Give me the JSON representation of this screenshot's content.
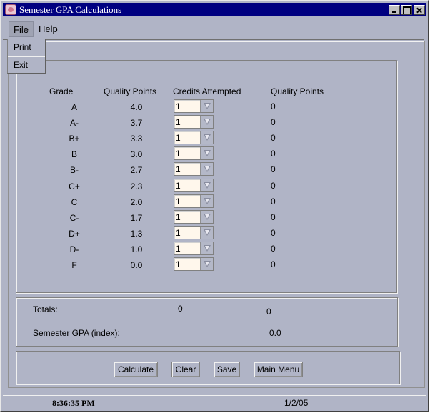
{
  "window": {
    "title": "Semester GPA Calculations",
    "controls": {
      "minimize": "minimize",
      "maximize": "maximize",
      "close": "close"
    }
  },
  "menubar": {
    "items": [
      {
        "label": "File",
        "mnemonic": "F",
        "rest": "ile",
        "open": true
      },
      {
        "label": "Help"
      }
    ],
    "file_menu": [
      {
        "label": "Print",
        "mnemonic": "P",
        "rest": "rint"
      },
      {
        "label": "Exit",
        "pre": "E",
        "mnemonic": "x",
        "rest": "it"
      }
    ]
  },
  "table": {
    "headers": {
      "grade": "Grade",
      "quality_points": "Quality Points",
      "credits": "Credits Attempted",
      "earned_points": "Quality Points"
    },
    "rows": [
      {
        "grade": "A",
        "qp": "4.0",
        "credits": "1",
        "earned": "0"
      },
      {
        "grade": "A-",
        "qp": "3.7",
        "credits": "1",
        "earned": "0"
      },
      {
        "grade": "B+",
        "qp": "3.3",
        "credits": "1",
        "earned": "0"
      },
      {
        "grade": "B",
        "qp": "3.0",
        "credits": "1",
        "earned": "0"
      },
      {
        "grade": "B-",
        "qp": "2.7",
        "credits": "1",
        "earned": "0"
      },
      {
        "grade": "C+",
        "qp": "2.3",
        "credits": "1",
        "earned": "0"
      },
      {
        "grade": "C",
        "qp": "2.0",
        "credits": "1",
        "earned": "0"
      },
      {
        "grade": "C-",
        "qp": "1.7",
        "credits": "1",
        "earned": "0"
      },
      {
        "grade": "D+",
        "qp": "1.3",
        "credits": "1",
        "earned": "0"
      },
      {
        "grade": "D-",
        "qp": "1.0",
        "credits": "1",
        "earned": "0"
      },
      {
        "grade": "F",
        "qp": "0.0",
        "credits": "1",
        "earned": "0"
      }
    ]
  },
  "totals": {
    "label": "Totals:",
    "credits_total": "0",
    "points_total": "0",
    "gpa_label": "Semester GPA (index):",
    "gpa_value": "0.0"
  },
  "buttons": {
    "calculate": "Calculate",
    "clear": "Clear",
    "save": "Save",
    "main_menu": "Main Menu"
  },
  "status": {
    "time": "8:36:35 PM",
    "date": "1/2/05"
  }
}
